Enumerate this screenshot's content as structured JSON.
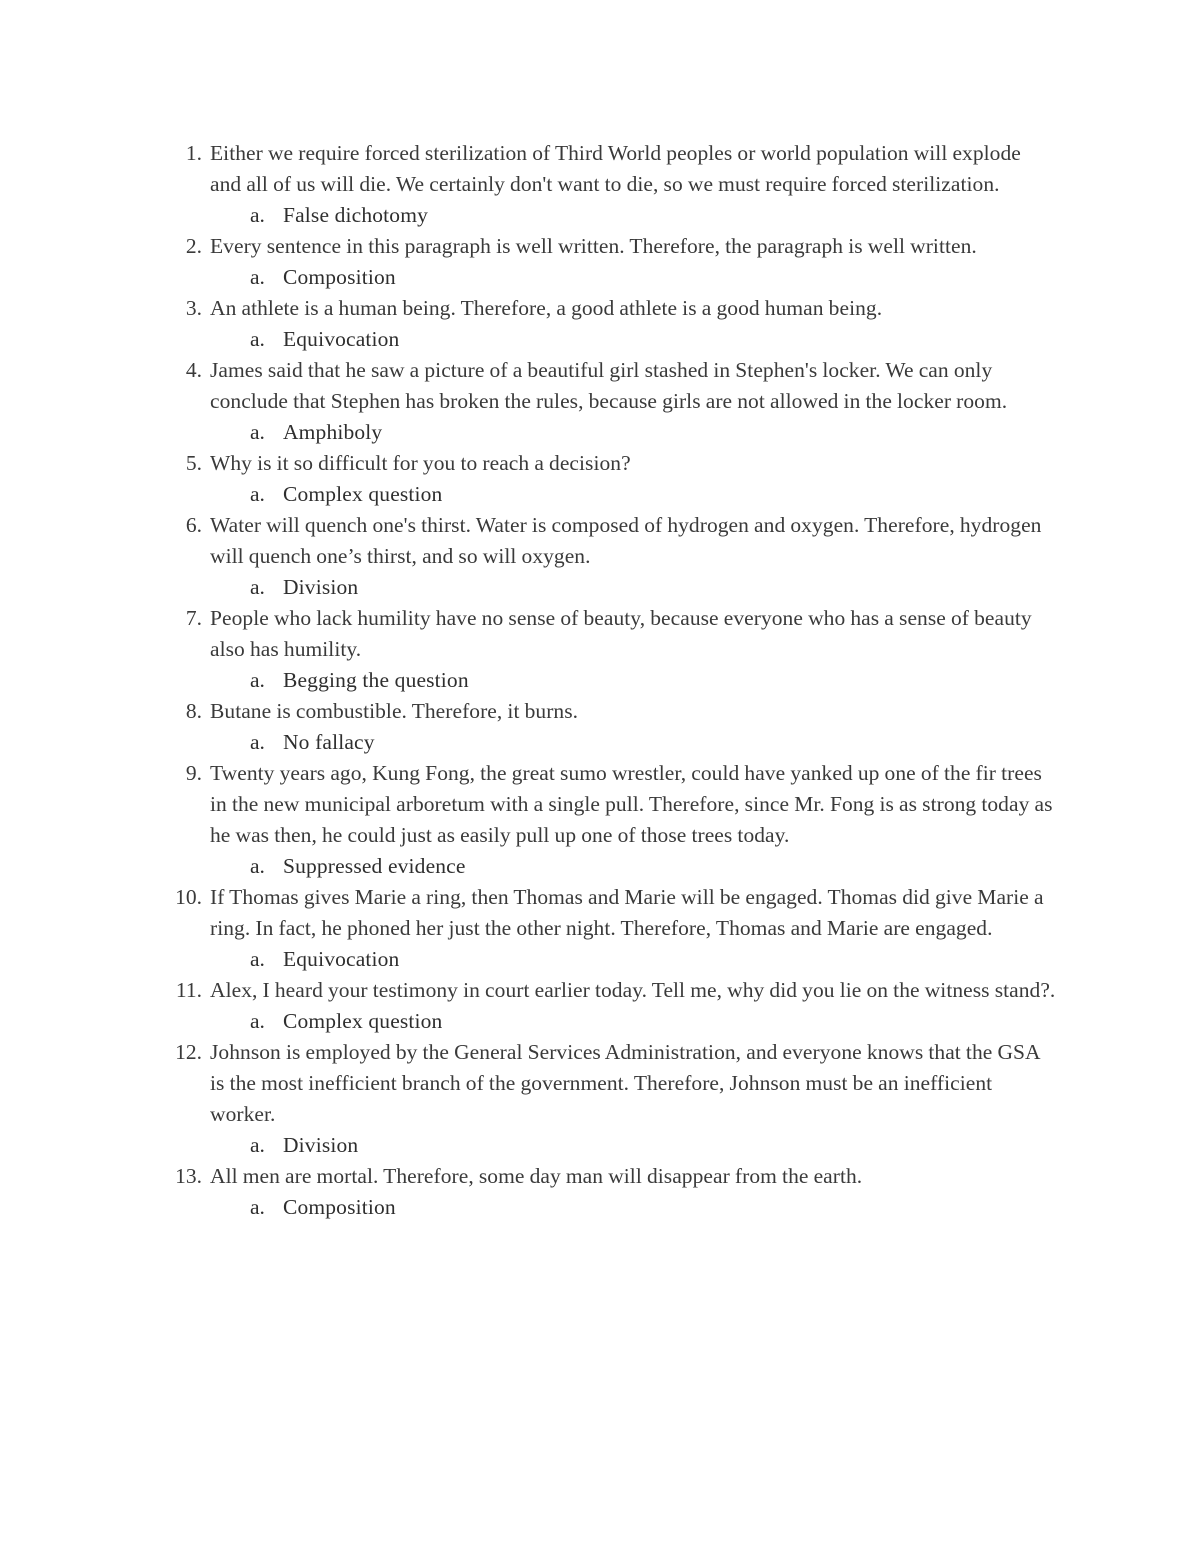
{
  "document": {
    "background_color": "#ffffff",
    "text_color": "#3a3a3a",
    "answer_text_color": "#2e2e2e"
  },
  "list": {
    "items": [
      {
        "number": "1.",
        "prompt": "Either we require forced sterilization of Third World peoples or world population will explode and all of us will die.  We certainly don't want to die, so we must require forced sterilization.",
        "answer_marker": "a.",
        "answer": "False dichotomy"
      },
      {
        "number": "2.",
        "prompt": "Every sentence in this paragraph is well written. Therefore, the paragraph is well written.",
        "answer_marker": "a.",
        "answer": "Composition"
      },
      {
        "number": "3.",
        "prompt": "An athlete is a human being.  Therefore, a good athlete is a good human being.",
        "answer_marker": "a.",
        "answer": "Equivocation"
      },
      {
        "number": "4.",
        "prompt": "James said that he saw a picture of a beautiful girl stashed in Stephen's locker. We can only conclude that Stephen has broken the rules, because girls are not allowed in the locker room.",
        "answer_marker": "a.",
        "answer": "Amphiboly"
      },
      {
        "number": "5.",
        "prompt": "Why is it so difficult for you to reach a decision?",
        "answer_marker": "a.",
        "answer": "Complex question"
      },
      {
        "number": "6.",
        "prompt": "Water will quench one's thirst. Water is composed of hydrogen and oxygen. Therefore, hydrogen will quench one’s thirst, and so will oxygen.",
        "answer_marker": "a.",
        "answer": "Division"
      },
      {
        "number": "7.",
        "prompt": "People who lack humility have no sense of beauty, because everyone who has a sense of beauty also has humility.",
        "answer_marker": "a.",
        "answer": "Begging the question"
      },
      {
        "number": "8.",
        "prompt": "Butane is combustible. Therefore, it burns.",
        "answer_marker": "a.",
        "answer": "No fallacy"
      },
      {
        "number": "9.",
        "prompt": "Twenty years ago, Kung Fong, the great sumo wrestler, could have yanked up one of the fir trees in the new municipal arboretum with a single pull. Therefore, since Mr. Fong is as strong today as he was then, he could just as easily pull up one of those trees today.",
        "answer_marker": "a.",
        "answer": "Suppressed evidence"
      },
      {
        "number": "10.",
        "prompt": "If Thomas gives Marie a ring, then Thomas and Marie will be engaged. Thomas did give Marie a ring. In fact, he phoned her just the other night. Therefore, Thomas and Marie are engaged.",
        "answer_marker": "a.",
        "answer": "Equivocation"
      },
      {
        "number": "11.",
        "prompt": "Alex, I heard your testimony in court earlier today. Tell me, why did you lie on the witness stand?.",
        "answer_marker": "a.",
        "answer": "Complex question"
      },
      {
        "number": "12.",
        "prompt": "Johnson is employed by the General Services Administration, and everyone knows that the GSA is the most inefficient branch of the government. Therefore, Johnson must be an inefficient worker.",
        "answer_marker": "a.",
        "answer": "Division"
      },
      {
        "number": "13.",
        "prompt": "All men are mortal. Therefore, some day man will disappear from the earth.",
        "answer_marker": "a.",
        "answer": "Composition"
      }
    ]
  }
}
